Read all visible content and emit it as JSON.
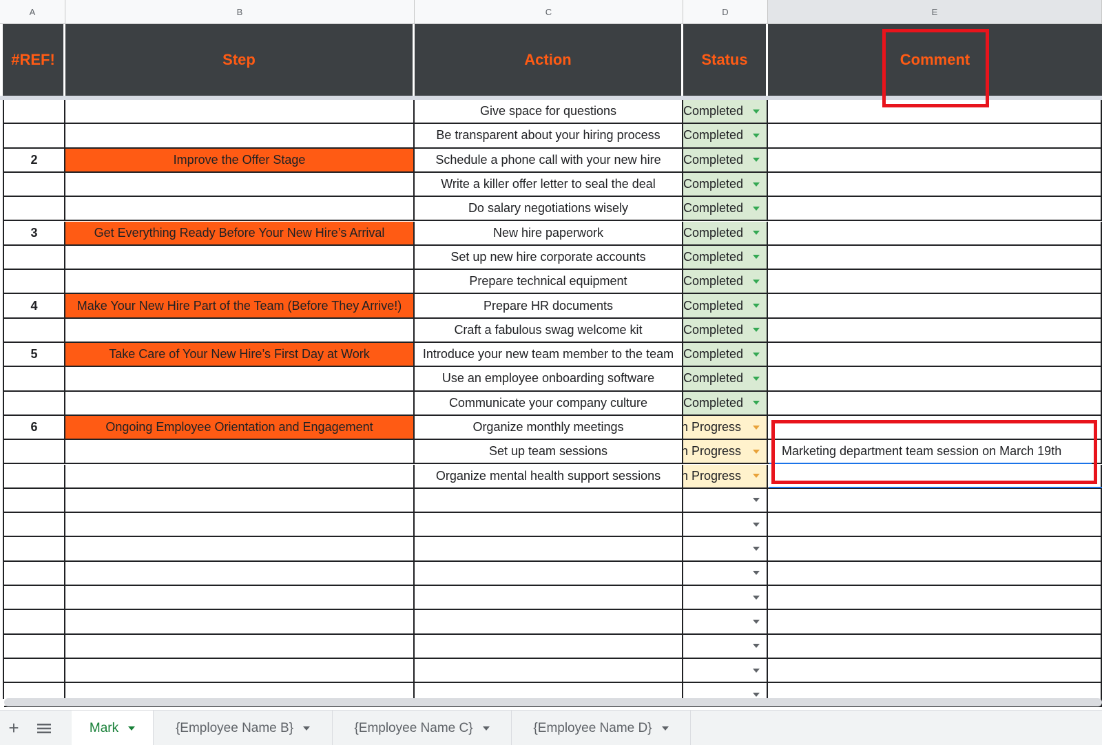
{
  "columns": [
    "A",
    "B",
    "C",
    "D",
    "E"
  ],
  "header": {
    "ref": "#REF!",
    "step": "Step",
    "action": "Action",
    "status": "Status",
    "comment": "Comment"
  },
  "rows": [
    {
      "num": "",
      "step": "",
      "action": "Give space for questions",
      "status": "Completed",
      "comment": ""
    },
    {
      "num": "",
      "step": "",
      "action": "Be transparent about your hiring process",
      "status": "Completed",
      "comment": ""
    },
    {
      "num": "2",
      "step": "Improve the Offer Stage",
      "action": "Schedule a phone call with your new hire",
      "status": "Completed",
      "comment": ""
    },
    {
      "num": "",
      "step": "",
      "action": "Write a killer offer letter to seal the deal",
      "status": "Completed",
      "comment": ""
    },
    {
      "num": "",
      "step": "",
      "action": "Do salary negotiations wisely",
      "status": "Completed",
      "comment": ""
    },
    {
      "num": "3",
      "step": "Get Everything Ready Before Your New Hire’s Arrival",
      "action": "New hire paperwork",
      "status": "Completed",
      "comment": ""
    },
    {
      "num": "",
      "step": "",
      "action": "Set up new hire corporate accounts",
      "status": "Completed",
      "comment": ""
    },
    {
      "num": "",
      "step": "",
      "action": "Prepare technical equipment",
      "status": "Completed",
      "comment": ""
    },
    {
      "num": "4",
      "step": "Make Your New Hire Part of the Team (Before They Arrive!)",
      "action": "Prepare HR documents",
      "status": "Completed",
      "comment": ""
    },
    {
      "num": "",
      "step": "",
      "action": "Craft a fabulous swag welcome kit",
      "status": "Completed",
      "comment": ""
    },
    {
      "num": "5",
      "step": "Take Care of Your New Hire’s First Day at Work",
      "action": "Introduce your new team member to the team",
      "status": "Completed",
      "comment": ""
    },
    {
      "num": "",
      "step": "",
      "action": "Use an employee onboarding software",
      "status": "Completed",
      "comment": ""
    },
    {
      "num": "",
      "step": "",
      "action": "Communicate your company culture",
      "status": "Completed",
      "comment": ""
    },
    {
      "num": "6",
      "step": "Ongoing Employee Orientation and Engagement",
      "action": "Organize monthly meetings",
      "status": "In Progress",
      "comment": ""
    },
    {
      "num": "",
      "step": "",
      "action": "Set up team sessions",
      "status": "In Progress",
      "comment": "Marketing department team session on March 19th"
    },
    {
      "num": "",
      "step": "",
      "action": "Organize mental health support sessions",
      "status": "In Progress",
      "comment": ""
    },
    {
      "num": "",
      "step": "",
      "action": "",
      "status": "",
      "comment": ""
    },
    {
      "num": "",
      "step": "",
      "action": "",
      "status": "",
      "comment": ""
    },
    {
      "num": "",
      "step": "",
      "action": "",
      "status": "",
      "comment": ""
    },
    {
      "num": "",
      "step": "",
      "action": "",
      "status": "",
      "comment": ""
    },
    {
      "num": "",
      "step": "",
      "action": "",
      "status": "",
      "comment": ""
    },
    {
      "num": "",
      "step": "",
      "action": "",
      "status": "",
      "comment": ""
    },
    {
      "num": "",
      "step": "",
      "action": "",
      "status": "",
      "comment": ""
    },
    {
      "num": "",
      "step": "",
      "action": "",
      "status": "",
      "comment": ""
    },
    {
      "num": "",
      "step": "",
      "action": "",
      "status": "",
      "comment": ""
    }
  ],
  "sheet_tabs": [
    {
      "label": "Mark",
      "active": true
    },
    {
      "label": "{Employee Name B}",
      "active": false
    },
    {
      "label": "{Employee Name C}",
      "active": false
    },
    {
      "label": "{Employee Name D}",
      "active": false
    }
  ],
  "colors": {
    "header_bg": "#3c4043",
    "header_text": "#ff5b14",
    "step_fill": "#ff5b14",
    "completed_fill": "#d9ead3",
    "in_progress_fill": "#fff2cc",
    "highlight": "#e8141c",
    "active_tab_text": "#188038"
  },
  "icons": {
    "add_sheet": "plus-icon",
    "all_sheets": "menu-icon",
    "dropdown": "chevron-down-icon"
  }
}
